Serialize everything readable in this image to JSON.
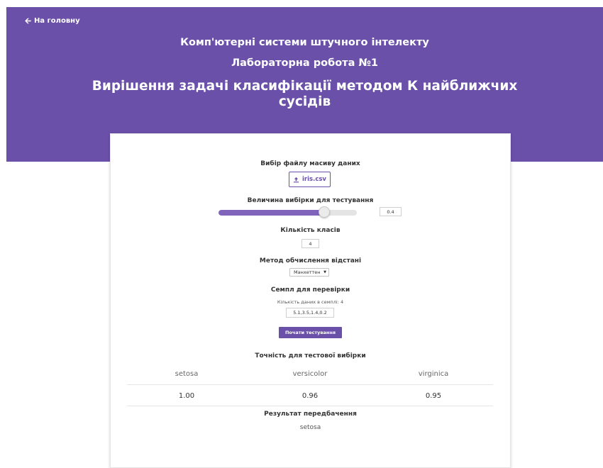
{
  "header": {
    "back_label": "На головну",
    "course": "Комп'ютерні системи штучного інтелекту",
    "lab": "Лабораторна робота №1",
    "title": "Вирішення задачі класифікації методом К найближчих сусідів"
  },
  "form": {
    "file_label": "Вибір файлу масиву даних",
    "file_name": "iris.csv",
    "test_size_label": "Величина вибірки для тестування",
    "test_size_value": "0.4",
    "slider_fraction": 0.76,
    "classes_label": "Кількість класів",
    "classes_value": "4",
    "distance_label": "Метод обчислення відстані",
    "distance_selected": "Манхеттен",
    "sample_label": "Семпл для перевірки",
    "sample_count_note": "Кількість даних в семплі: 4",
    "sample_value": "5.1,3.5,1.4,0.2",
    "test_button": "Почати тестування"
  },
  "accuracy": {
    "title": "Точність для тестової вибірки",
    "columns": [
      "setosa",
      "versicolor",
      "virginica"
    ],
    "values": [
      "1.00",
      "0.96",
      "0.95"
    ]
  },
  "prediction": {
    "title": "Результат передбачення",
    "value": "setosa"
  },
  "colors": {
    "accent": "#6a50a8",
    "slider_fill": "#8064bc"
  }
}
